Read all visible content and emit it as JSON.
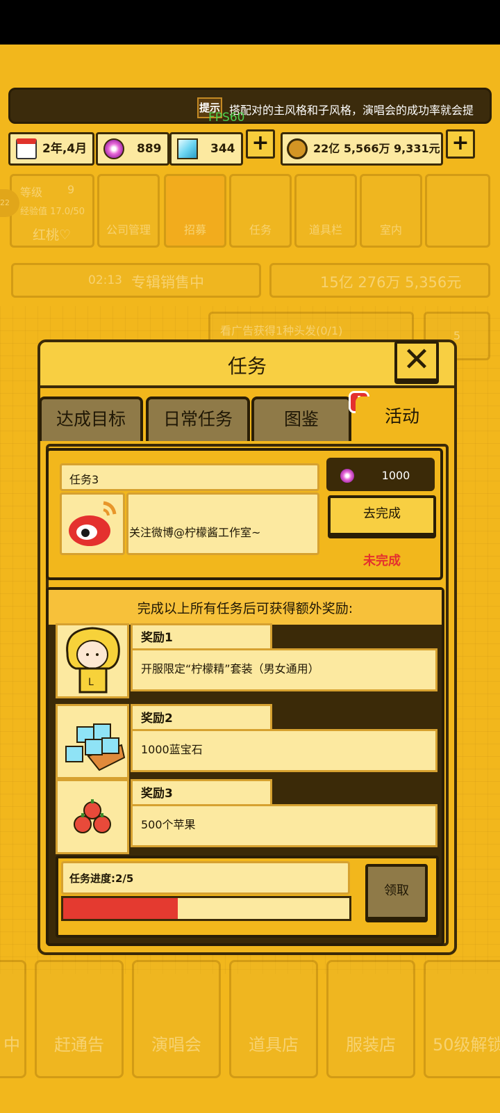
{
  "status_bar": {},
  "hint": {
    "icon_text": "提示",
    "text": "搭配对的主风格和子风格，演唱会的成功率就会提",
    "fps": "FPS60"
  },
  "resources": {
    "date": "2年,4月",
    "pink_gems": "889",
    "blue_gems": "344",
    "money": "22亿 5,566万 9,331元",
    "plus_symbol": "+"
  },
  "background": {
    "level_label": "等级",
    "level_value": "9",
    "exp_label": "经验值 17.0/50",
    "player_name": "红桃♡",
    "avatar_badge": "22",
    "menu": [
      "公司管理",
      "招募",
      "任务",
      "道具栏",
      "室内"
    ],
    "sales_timer": "02:13",
    "sales_text": "专辑销售中",
    "sales_money": "15亿 276万 5,356元",
    "ad_text": "看广告获得1种头发(0/1)",
    "side_count": "5",
    "bottom_menu": [
      "中",
      "赶通告",
      "演唱会",
      "道具店",
      "服装店",
      "50级解锁"
    ]
  },
  "modal": {
    "title": "任务",
    "close_symbol": "✕",
    "tabs": [
      {
        "label": "达成目标",
        "active": false
      },
      {
        "label": "日常任务",
        "active": false
      },
      {
        "label": "图鉴",
        "active": false,
        "alert": true
      },
      {
        "label": "活动",
        "active": true
      }
    ],
    "alert_symbol": "!",
    "task": {
      "name": "任务3",
      "description": "关注微博@柠檬酱工作室~",
      "icon": "weibo-icon",
      "reward_amount": "1000",
      "reward_icon": "pink-gem-icon",
      "action_label": "去完成",
      "status": "未完成"
    },
    "bonus": {
      "title": "完成以上所有任务后可获得额外奖励:",
      "rewards": [
        {
          "tag": "奖励1",
          "desc": "开服限定“柠檬精”套装（男女通用）",
          "icon": "lemon-costume-icon"
        },
        {
          "tag": "奖励2",
          "desc": "1000蓝宝石",
          "icon": "blue-gems-icon"
        },
        {
          "tag": "奖励3",
          "desc": "500个苹果",
          "icon": "apples-icon"
        }
      ]
    },
    "progress": {
      "label": "任务进度:2/5",
      "current": 2,
      "total": 5,
      "claim_label": "领取"
    }
  },
  "colors": {
    "background": "#f2b71c",
    "dark_border": "#2a1e06",
    "panel_light": "#fce9a0",
    "alert_red": "#e4312e",
    "progress_red": "#e43a30"
  }
}
